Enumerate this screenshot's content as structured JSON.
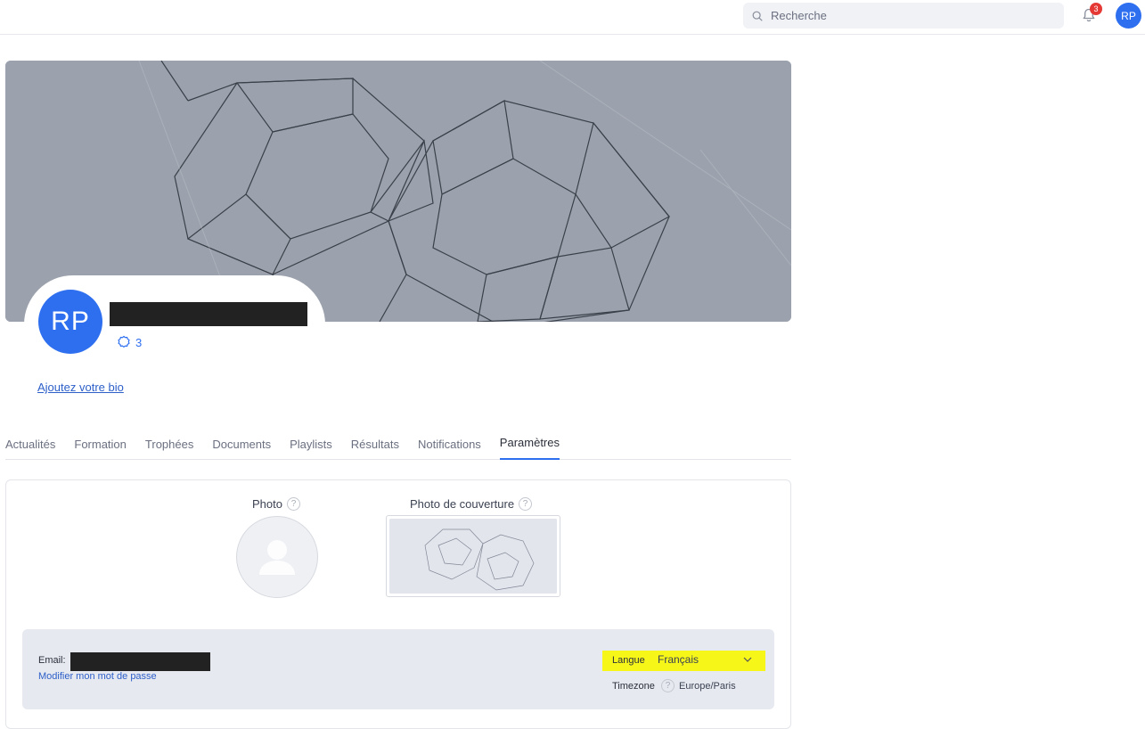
{
  "topbar": {
    "search_placeholder": "Recherche",
    "notification_count": "3",
    "avatar_initials": "RP"
  },
  "profile": {
    "avatar_initials": "RP",
    "points": "3",
    "bio_link": "Ajoutez votre bio"
  },
  "tabs": [
    {
      "label": "Actualités"
    },
    {
      "label": "Formation"
    },
    {
      "label": "Trophées"
    },
    {
      "label": "Documents"
    },
    {
      "label": "Playlists"
    },
    {
      "label": "Résultats"
    },
    {
      "label": "Notifications"
    },
    {
      "label": "Paramètres",
      "active": true
    }
  ],
  "settings": {
    "photo_label": "Photo",
    "cover_label": "Photo de couverture",
    "help_glyph": "?",
    "email_label": "Email:",
    "change_password": "Modifier mon mot de passe",
    "language_label": "Langue",
    "language_value": "Français",
    "timezone_label": "Timezone",
    "timezone_value": "Europe/Paris"
  },
  "colors": {
    "accent": "#2e6ff0",
    "badge": "#e53935",
    "highlight": "#f6f619"
  }
}
